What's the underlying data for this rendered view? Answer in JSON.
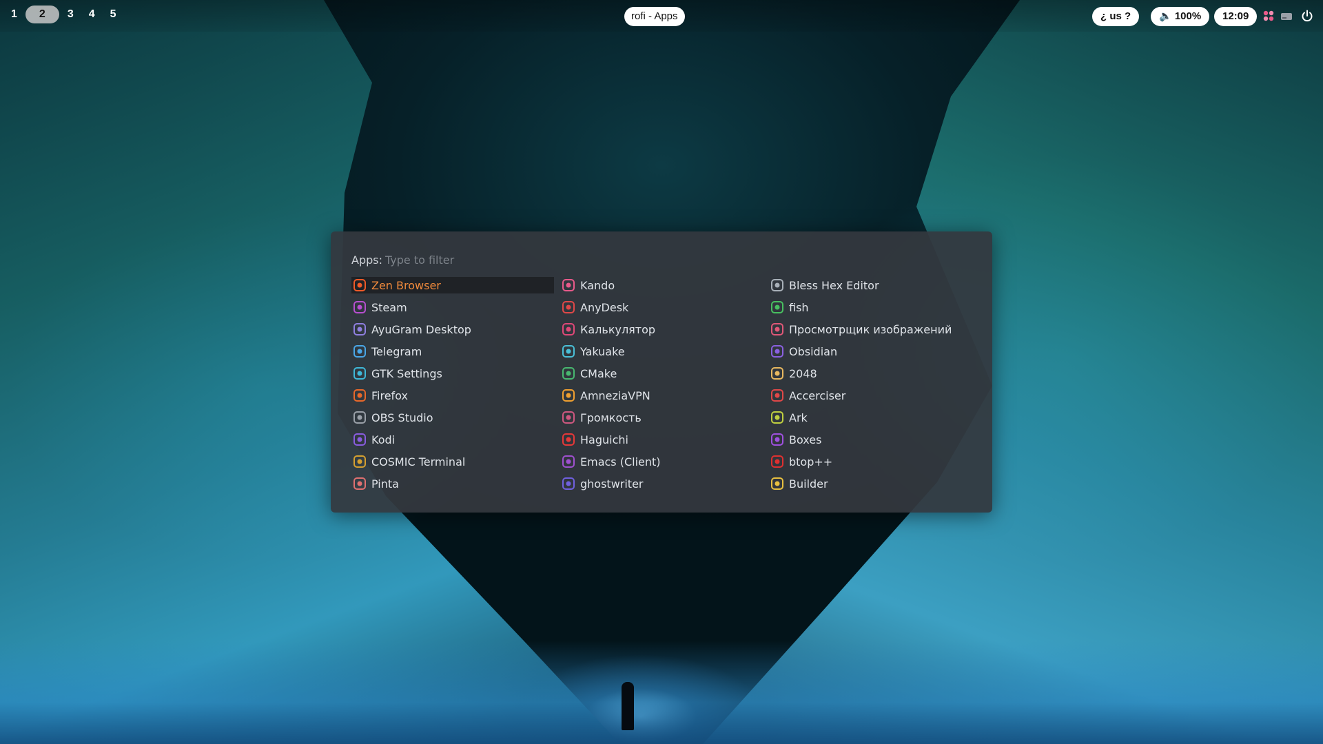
{
  "topbar": {
    "workspaces": [
      {
        "label": "1",
        "active": false
      },
      {
        "label": "2",
        "active": true
      },
      {
        "label": "3",
        "active": false
      },
      {
        "label": "4",
        "active": false
      },
      {
        "label": "5",
        "active": false
      }
    ],
    "window_title": "rofi - Apps",
    "keyboard_layout": "¿ us ?",
    "volume": "🔈 100%",
    "clock": "12:09",
    "tray_icons": [
      "kando-icon",
      "disk-icon",
      "power-icon"
    ]
  },
  "launcher": {
    "prompt_label": "Apps:",
    "placeholder": "Type to filter",
    "columns": [
      [
        {
          "label": "Zen Browser",
          "icon": "zen-icon",
          "color": "#f05a28",
          "selected": true
        },
        {
          "label": "Steam",
          "icon": "steam-icon",
          "color": "#b84fd0"
        },
        {
          "label": "AyuGram Desktop",
          "icon": "ayugram-icon",
          "color": "#8f7fe0"
        },
        {
          "label": "Telegram",
          "icon": "telegram-icon",
          "color": "#4aa7e8"
        },
        {
          "label": "GTK Settings",
          "icon": "gtk-settings-icon",
          "color": "#3fb8d8"
        },
        {
          "label": "Firefox",
          "icon": "firefox-icon",
          "color": "#e8682a"
        },
        {
          "label": "OBS Studio",
          "icon": "obs-icon",
          "color": "#9aa0a8"
        },
        {
          "label": "Kodi",
          "icon": "kodi-icon",
          "color": "#8a5ce0"
        },
        {
          "label": "COSMIC Terminal",
          "icon": "terminal-icon",
          "color": "#d6a030"
        },
        {
          "label": "Pinta",
          "icon": "pinta-icon",
          "color": "#e07070"
        }
      ],
      [
        {
          "label": "Kando",
          "icon": "kando-icon",
          "color": "#e85a8a"
        },
        {
          "label": "AnyDesk",
          "icon": "anydesk-icon",
          "color": "#e04848"
        },
        {
          "label": "Калькулятор",
          "icon": "calculator-icon",
          "color": "#e04878"
        },
        {
          "label": "Yakuake",
          "icon": "yakuake-icon",
          "color": "#4ac0d8"
        },
        {
          "label": "CMake",
          "icon": "cmake-icon",
          "color": "#48b870"
        },
        {
          "label": "AmneziaVPN",
          "icon": "amneziavpn-icon",
          "color": "#f0a030"
        },
        {
          "label": "Громкость",
          "icon": "volume-control-icon",
          "color": "#d05880"
        },
        {
          "label": "Haguichi",
          "icon": "haguichi-icon",
          "color": "#e83838"
        },
        {
          "label": "Emacs (Client)",
          "icon": "emacs-icon",
          "color": "#a050d0"
        },
        {
          "label": "ghostwriter",
          "icon": "ghostwriter-icon",
          "color": "#7060e0"
        }
      ],
      [
        {
          "label": "Bless Hex Editor",
          "icon": "hex-editor-icon",
          "color": "#a8b0b8"
        },
        {
          "label": "fish",
          "icon": "fish-icon",
          "color": "#48c060"
        },
        {
          "label": "Просмотрщик изображений",
          "icon": "image-viewer-icon",
          "color": "#e05878"
        },
        {
          "label": "Obsidian",
          "icon": "obsidian-icon",
          "color": "#8a60e0"
        },
        {
          "label": "2048",
          "icon": "game-2048-icon",
          "color": "#e8b860"
        },
        {
          "label": "Accerciser",
          "icon": "accerciser-icon",
          "color": "#e04848"
        },
        {
          "label": "Ark",
          "icon": "ark-icon",
          "color": "#c0d040"
        },
        {
          "label": "Boxes",
          "icon": "boxes-icon",
          "color": "#a050e0"
        },
        {
          "label": "btop++",
          "icon": "btop-icon",
          "color": "#e03030"
        },
        {
          "label": "Builder",
          "icon": "builder-icon",
          "color": "#e8c040"
        }
      ]
    ]
  }
}
